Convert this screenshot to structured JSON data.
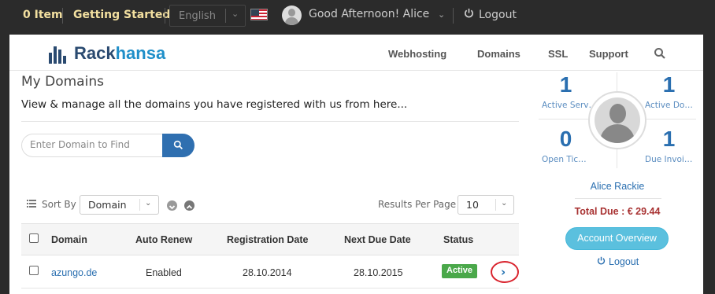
{
  "topbar": {
    "cart": "0 Item",
    "getting_started": "Getting Started",
    "language": "English",
    "greeting": "Good Afternoon! Alice",
    "logout": "Logout",
    "flag": "us-flag"
  },
  "brand": {
    "part1": "Rack",
    "part2": "hansa",
    "color_dark": "#2a4a70",
    "color_light": "#1f8fc9"
  },
  "nav": {
    "items": [
      "Webhosting",
      "Domains",
      "SSL",
      "Support"
    ],
    "search_icon": "search-icon"
  },
  "main": {
    "title": "My Domains",
    "subtitle": "View & manage all the domains you have registered with us from here...",
    "search_placeholder": "Enter Domain to Find",
    "sort_by_label": "Sort By",
    "sort_value": "Domain",
    "results_per_page_label": "Results Per Page",
    "results_per_page_value": "10"
  },
  "table": {
    "headers": [
      "Domain",
      "Auto Renew",
      "Registration Date",
      "Next Due Date",
      "Status"
    ],
    "rows": [
      {
        "domain": "azungo.de",
        "auto_renew": "Enabled",
        "registration_date": "28.10.2014",
        "next_due_date": "28.10.2015",
        "status": "Active",
        "status_color": "#4aa84a"
      }
    ]
  },
  "sidebar": {
    "stats": [
      {
        "value": "1",
        "label": "Active Services"
      },
      {
        "value": "1",
        "label": "Active Domains"
      },
      {
        "value": "0",
        "label": "Open Tickets"
      },
      {
        "value": "1",
        "label": "Due Invoices"
      }
    ],
    "user_name": "Alice Rackie",
    "total_due": "Total Due : € 29.44",
    "account_overview": "Account Overview",
    "logout": "Logout"
  }
}
